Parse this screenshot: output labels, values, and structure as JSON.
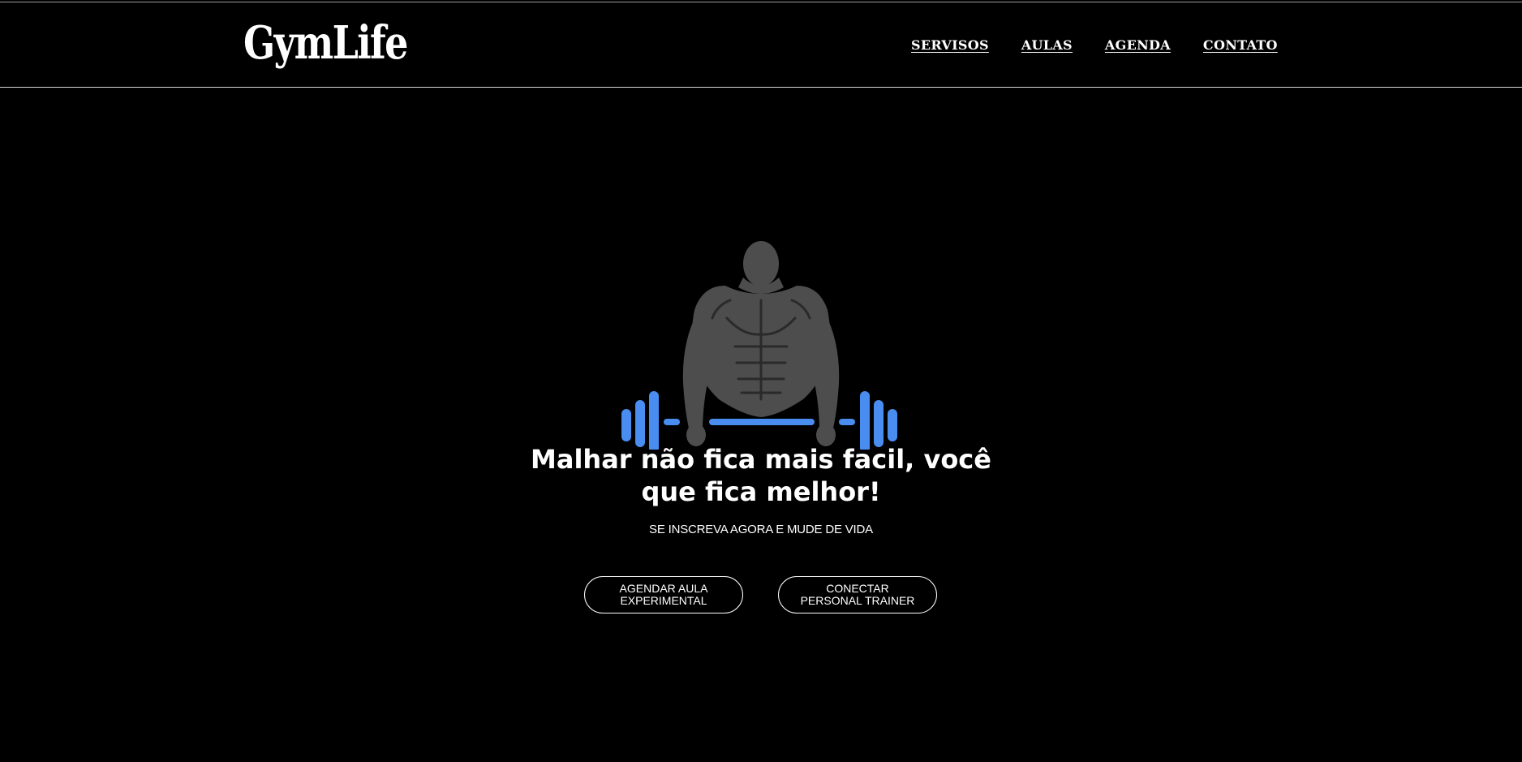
{
  "header": {
    "logo": "GymLife",
    "nav": [
      {
        "label": "SERVISOS"
      },
      {
        "label": "AULAS"
      },
      {
        "label": "AGENDA"
      },
      {
        "label": "CONTATO"
      }
    ]
  },
  "hero": {
    "illustration_icon": "bodybuilder-barbell-icon",
    "headline": "Malhar não fica mais facil, você que fica melhor!",
    "subheadline": "SE INSCREVA AGORA E MUDE DE VIDA",
    "buttons": {
      "trial_class": "AGENDAR AULA EXPERIMENTAL",
      "personal_trainer": "CONECTAR PERSONAL TRAINER"
    }
  },
  "colors": {
    "background": "#000000",
    "accent_blue": "#4a8df0",
    "figure_gray": "#4d4d4d",
    "text": "#ffffff"
  }
}
